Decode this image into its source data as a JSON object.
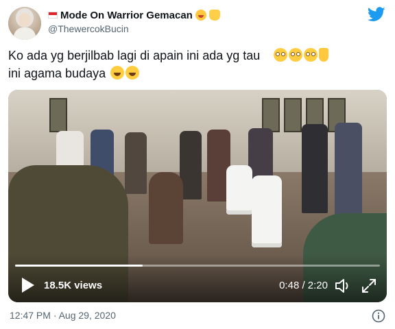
{
  "author": {
    "display_name": "Mode On Warrior Gemacan",
    "handle": "@ThewercokBucin",
    "name_emojis": [
      "face-savoring-food-emoji",
      "raised-hands-emoji"
    ],
    "flag": "indonesia-flag-icon"
  },
  "tweet": {
    "text_line1": "Ko ada yg berjilbab lagi di apain ini ada yg tau",
    "text_line2": "ini agama budaya",
    "line1_emojis": [
      "flushed-face-emoji",
      "flushed-face-emoji",
      "flushed-face-emoji",
      "backhand-index-pointing-down-emoji"
    ],
    "line2_emojis": [
      "rolling-on-floor-laughing-emoji",
      "rolling-on-floor-laughing-emoji"
    ]
  },
  "video": {
    "views": "18.5K views",
    "time": "0:48 / 2:20",
    "progress_fraction": 0.35,
    "play_icon": "play-icon",
    "volume_icon": "volume-icon",
    "expand_icon": "expand-icon"
  },
  "footer": {
    "timestamp": "12:47 PM · Aug 29, 2020",
    "info_icon": "info-icon"
  },
  "colors": {
    "twitter_blue": "#1d9bf0",
    "text_primary": "#0f1419",
    "text_secondary": "#536471"
  }
}
